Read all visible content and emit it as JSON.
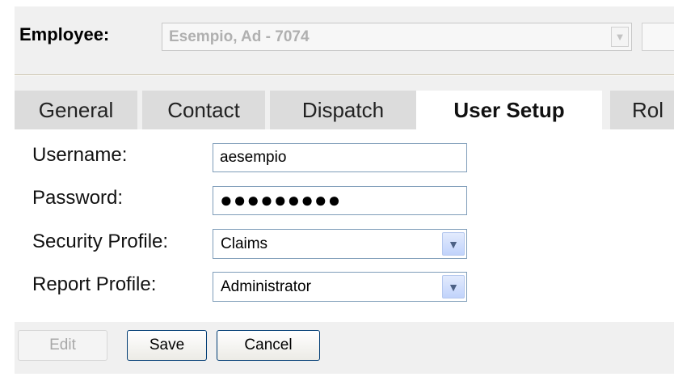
{
  "employee": {
    "label": "Employee:",
    "selected": "Esempio, Ad - 7074",
    "arrow_icon": "chevron-down-icon"
  },
  "tabs": [
    {
      "label": "General",
      "active": false
    },
    {
      "label": "Contact",
      "active": false
    },
    {
      "label": "Dispatch",
      "active": false
    },
    {
      "label": "User Setup",
      "active": true
    },
    {
      "label": "Rol",
      "active": false
    }
  ],
  "form": {
    "username_label": "Username:",
    "username_value": "aesempio",
    "password_label": "Password:",
    "password_value": "●●●●●●●●●",
    "security_label": "Security Profile:",
    "security_value": "Claims",
    "report_label": "Report Profile:",
    "report_value": "Administrator"
  },
  "buttons": {
    "edit": "Edit",
    "save": "Save",
    "cancel": "Cancel"
  },
  "colors": {
    "accent_border": "#7f9db9",
    "button_border": "#003c74",
    "tab_inactive": "#dcdcdc"
  }
}
